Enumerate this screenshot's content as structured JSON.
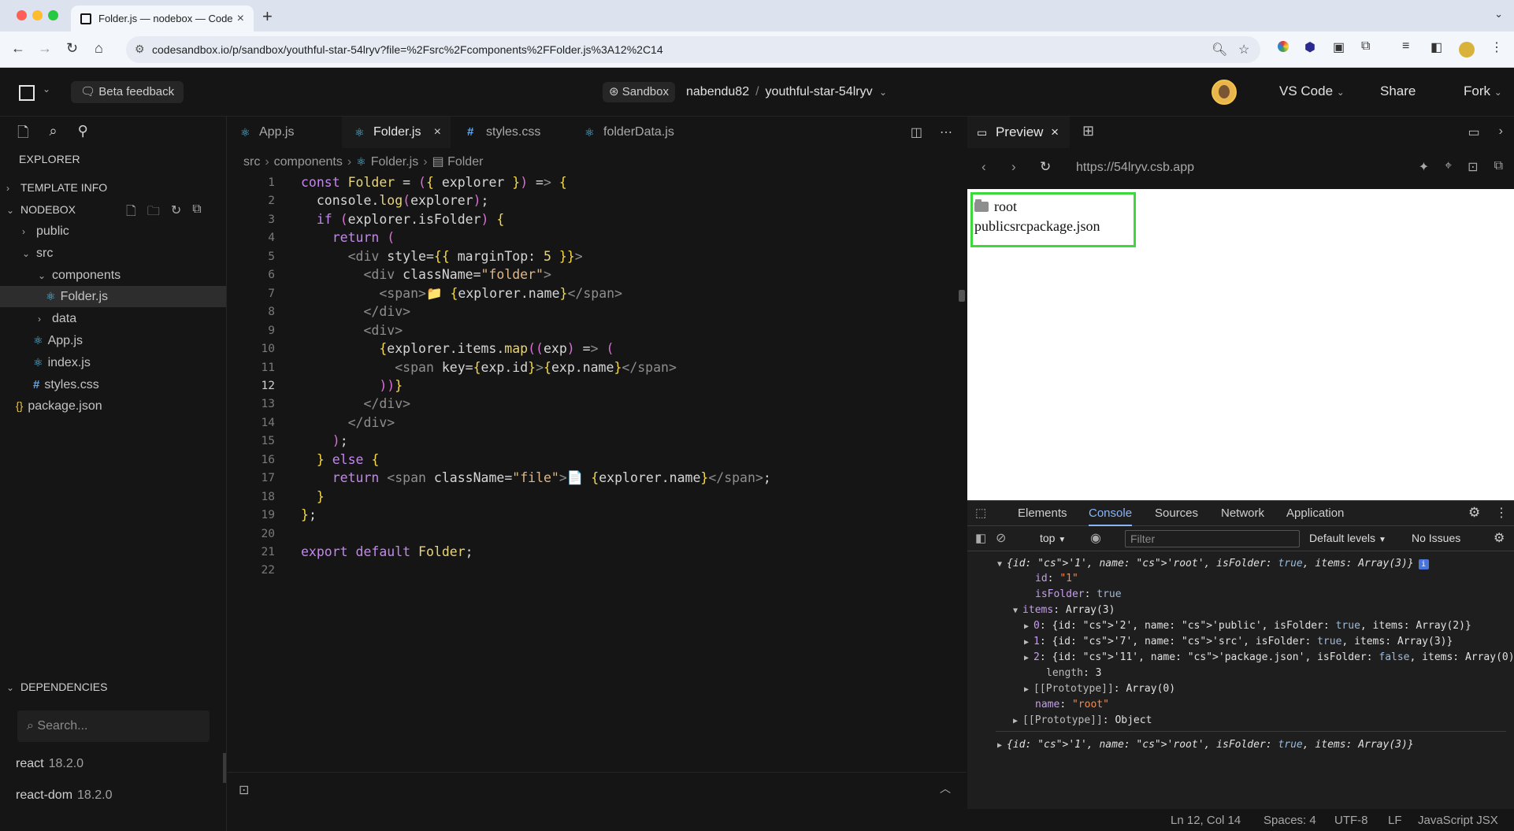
{
  "browser": {
    "tab_title": "Folder.js — nodebox — Code",
    "url": "codesandbox.io/p/sandbox/youthful-star-54lryv?file=%2Fsrc%2Fcomponents%2FFolder.js%3A12%2C14"
  },
  "header": {
    "beta_feedback": "Beta feedback",
    "sandbox_label": "Sandbox",
    "owner": "nabendu82",
    "separator": "/",
    "project": "youthful-star-54lryv",
    "vscode": "VS Code",
    "share": "Share",
    "fork": "Fork"
  },
  "sidebar": {
    "explorer_title": "EXPLORER",
    "template_info": "TEMPLATE INFO",
    "nodebox": "NODEBOX",
    "tree": [
      {
        "label": "public",
        "type": "folder",
        "depth": 1,
        "expanded": false
      },
      {
        "label": "src",
        "type": "folder",
        "depth": 1,
        "expanded": true
      },
      {
        "label": "components",
        "type": "folder",
        "depth": 2,
        "expanded": true
      },
      {
        "label": "Folder.js",
        "type": "react",
        "depth": 3,
        "selected": true
      },
      {
        "label": "data",
        "type": "folder",
        "depth": 2,
        "expanded": false
      },
      {
        "label": "App.js",
        "type": "react",
        "depth": 2
      },
      {
        "label": "index.js",
        "type": "react",
        "depth": 2
      },
      {
        "label": "styles.css",
        "type": "css",
        "depth": 2
      },
      {
        "label": "package.json",
        "type": "json",
        "depth": 1
      }
    ],
    "dependencies_title": "DEPENDENCIES",
    "search_placeholder": "Search...",
    "deps": [
      {
        "name": "react",
        "version": "18.2.0"
      },
      {
        "name": "react-dom",
        "version": "18.2.0"
      }
    ]
  },
  "editor": {
    "tabs": [
      {
        "label": "App.js",
        "icon": "react-icon",
        "active": false
      },
      {
        "label": "Folder.js",
        "icon": "react-icon",
        "active": true
      },
      {
        "label": "styles.css",
        "icon": "css-icon",
        "active": false
      },
      {
        "label": "folderData.js",
        "icon": "react-icon",
        "active": false
      }
    ],
    "breadcrumb": [
      "src",
      "components",
      "Folder.js",
      "Folder"
    ],
    "current_line": 12,
    "lines": [
      "const Folder = ({ explorer }) => {",
      "  console.log(explorer);",
      "  if (explorer.isFolder) {",
      "    return (",
      "      <div style={{ marginTop: 5 }}>",
      "        <div className=\"folder\">",
      "          <span>📁 {explorer.name}</span>",
      "        </div>",
      "        <div>",
      "          {explorer.items.map((exp) => (",
      "            <span key={exp.id}>{exp.name}</span>",
      "          ))}",
      "        </div>",
      "      </div>",
      "    );",
      "  } else {",
      "    return <span className=\"file\">📄 {explorer.name}</span>;",
      "  }",
      "};",
      "",
      "export default Folder;",
      ""
    ]
  },
  "preview": {
    "tab_label": "Preview",
    "url": "https://54lryv.csb.app",
    "root_label": "root",
    "items_text": "publicsrcpackage.json"
  },
  "devtools": {
    "tabs": [
      "Elements",
      "Console",
      "Sources",
      "Network",
      "Application"
    ],
    "active_tab": "Console",
    "context": "top",
    "filter_placeholder": "Filter",
    "levels": "Default levels",
    "issues": "No Issues",
    "console_lines": [
      "{id: '1', name: 'root', isFolder: true, items: Array(3)}",
      "id: \"1\"",
      "isFolder: true",
      "items: Array(3)",
      "0: {id: '2', name: 'public', isFolder: true, items: Array(2)}",
      "1: {id: '7', name: 'src', isFolder: true, items: Array(3)}",
      "2: {id: '11', name: 'package.json', isFolder: false, items: Array(0)}",
      "length: 3",
      "[[Prototype]]: Array(0)",
      "name: \"root\"",
      "[[Prototype]]: Object",
      "{id: '1', name: 'root', isFolder: true, items: Array(3)}"
    ]
  },
  "status": {
    "position": "Ln 12, Col 14",
    "spaces": "Spaces: 4",
    "encoding": "UTF-8",
    "eol": "LF",
    "language": "JavaScript JSX"
  }
}
